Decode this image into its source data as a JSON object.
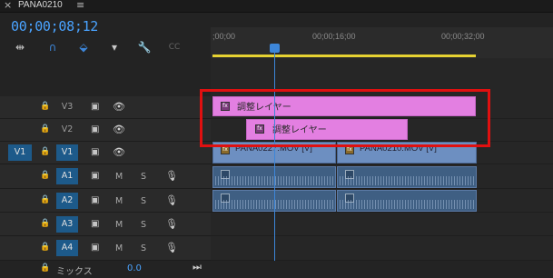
{
  "tab": {
    "close": "×",
    "title": "PANA0210",
    "menu": "≡"
  },
  "timecode": "00;00;08;12",
  "toolbar": {
    "snap_icon": "⇹",
    "magnet_icon": "∩",
    "linked_icon": "⬙",
    "marker_icon": "▾",
    "wrench_icon": "🔧",
    "cc_icon": "CC"
  },
  "ruler": {
    "labels": [
      ";00;00",
      "00;00;16;00",
      "00;00;32;00"
    ]
  },
  "tracks": {
    "video": [
      {
        "name": "V3",
        "lock": "🔒",
        "film": "▣",
        "eye": "👁"
      },
      {
        "name": "V2",
        "lock": "🔒",
        "film": "▣",
        "eye": "👁"
      },
      {
        "name": "V1",
        "source": "V1",
        "lock": "🔒",
        "film": "▣",
        "eye": "👁"
      }
    ],
    "audio": [
      {
        "name": "A1",
        "lock": "🔒",
        "film": "▣",
        "m": "M",
        "s": "S",
        "mic": "🎙"
      },
      {
        "name": "A2",
        "lock": "🔒",
        "film": "▣",
        "m": "M",
        "s": "S",
        "mic": "🎙"
      },
      {
        "name": "A3",
        "lock": "🔒",
        "film": "▣",
        "m": "M",
        "s": "S",
        "mic": "🎙"
      },
      {
        "name": "A4",
        "lock": "🔒",
        "film": "▣",
        "m": "M",
        "s": "S",
        "mic": "🎙"
      }
    ]
  },
  "clips": {
    "adj1": {
      "fx": "fx",
      "label": "調整レイヤー"
    },
    "adj2": {
      "fx": "fx",
      "label": "調整レイヤー"
    },
    "v1a": {
      "fx": "fx",
      "label": "PANA0227.MOV [V]"
    },
    "v1b": {
      "fx": "fx",
      "label": "PANA0210.MOV [V]"
    }
  },
  "mix": {
    "lock": "🔒",
    "label": "ミックス",
    "value": "0.0",
    "end_icon": "⏭"
  },
  "colors": {
    "accent": "#4aa3ff",
    "adjustment_clip": "#e37fe1",
    "video_clip": "#6d8fc1",
    "audio_clip": "#3f5f83",
    "highlight": "#e01010"
  }
}
